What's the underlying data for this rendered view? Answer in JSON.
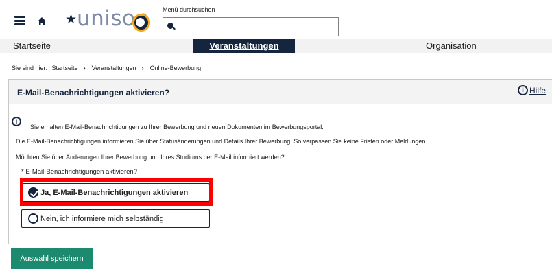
{
  "header": {
    "logo_text": "unison",
    "search_label": "Menü durchsuchen",
    "search_placeholder": ""
  },
  "nav": {
    "items": [
      {
        "label": "Startseite"
      },
      {
        "label": "Veranstaltungen"
      },
      {
        "label": "Organisation"
      }
    ]
  },
  "breadcrumb": {
    "prefix": "Sie sind hier:",
    "items": [
      "Startseite",
      "Veranstaltungen",
      "Online-Bewerbung"
    ]
  },
  "panel": {
    "title": "E-Mail-Benachrichtigungen aktivieren?",
    "help_label": "Hilfe",
    "info_text": "Sie erhalten E-Mail-Benachrichtigungen zu Ihrer Bewerbung und neuen Dokumenten im Bewerbungsportal.",
    "paragraph1": "Die E-Mail-Benachrichtigungen informieren Sie über Statusänderungen und Details Ihrer Bewerbung. So verpassen Sie keine Fristen oder Meldungen.",
    "paragraph2": "Möchten Sie über Änderungen Ihrer Bewerbung und Ihres Studiums per E-Mail informiert werden?",
    "question": "* E-Mail-Benachrichtigungen aktivieren?",
    "options": [
      {
        "label": "Ja, E-Mail-Benachrichtigungen aktivieren",
        "selected": true
      },
      {
        "label": "Nein, ich informiere mich selbständig",
        "selected": false
      }
    ]
  },
  "actions": {
    "save_label": "Auswahl speichern"
  },
  "colors": {
    "primary": "#14253d",
    "accent": "#f7a81b",
    "button": "#1b8a6e",
    "highlight": "#ff0000"
  }
}
